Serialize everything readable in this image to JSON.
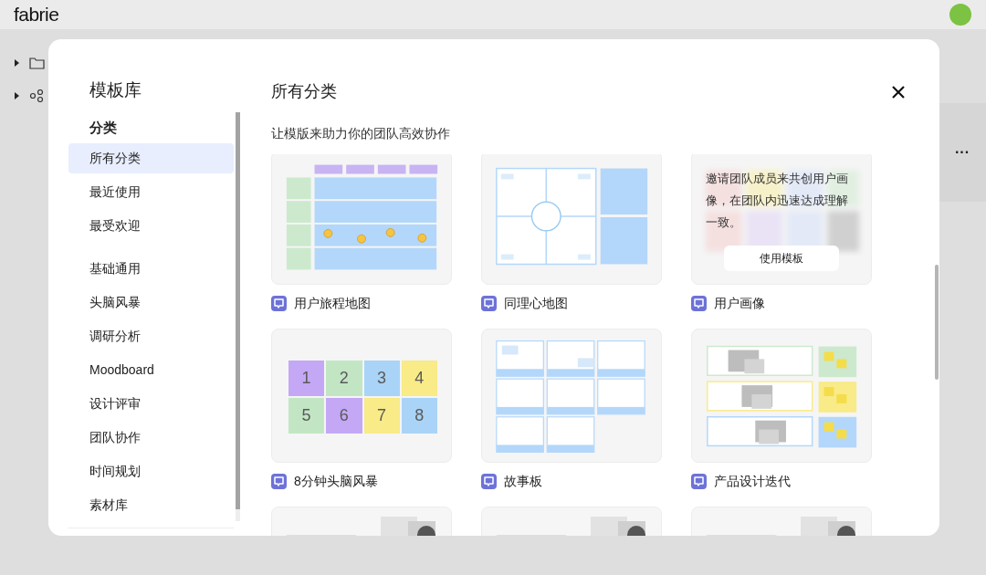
{
  "app": {
    "logo": "fabrie",
    "more": "···"
  },
  "modal": {
    "title": "模板库",
    "section": "分类",
    "nav_groups": [
      {
        "items": [
          {
            "label": "所有分类",
            "selected": true
          },
          {
            "label": "最近使用",
            "selected": false
          },
          {
            "label": "最受欢迎",
            "selected": false
          }
        ]
      },
      {
        "items": [
          {
            "label": "基础通用",
            "selected": false
          },
          {
            "label": "头脑风暴",
            "selected": false
          },
          {
            "label": "调研分析",
            "selected": false
          },
          {
            "label": "Moodboard",
            "selected": false
          },
          {
            "label": "设计评审",
            "selected": false
          },
          {
            "label": "团队协作",
            "selected": false
          },
          {
            "label": "时间规划",
            "selected": false
          },
          {
            "label": "素材库",
            "selected": false
          }
        ]
      }
    ],
    "heading": "所有分类",
    "subtitle": "让模版来助力你的团队高效协作",
    "templates": [
      {
        "kind": "journey-map",
        "label": "用户旅程地图"
      },
      {
        "kind": "empathy-map",
        "label": "同理心地图"
      },
      {
        "kind": "persona",
        "label": "用户画像",
        "hovered": true,
        "description": "邀请团队成员来共创用户画像，在团队内迅速达成理解一致。",
        "button": "使用模板"
      },
      {
        "kind": "brainstorm",
        "label": "8分钟头脑风暴",
        "cells": [
          {
            "text": "1",
            "color": "#c4a8f5"
          },
          {
            "text": "2",
            "color": "#c2e6c4"
          },
          {
            "text": "3",
            "color": "#a9d4f7"
          },
          {
            "text": "4",
            "color": "#f8eb88"
          },
          {
            "text": "5",
            "color": "#c2e6c4"
          },
          {
            "text": "6",
            "color": "#c4a8f5"
          },
          {
            "text": "7",
            "color": "#f8eb88"
          },
          {
            "text": "8",
            "color": "#a9d4f7"
          }
        ]
      },
      {
        "kind": "storyboard",
        "label": "故事板"
      },
      {
        "kind": "iteration",
        "label": "产品设计迭代"
      },
      {
        "kind": "picture"
      },
      {
        "kind": "picture"
      },
      {
        "kind": "picture"
      }
    ]
  }
}
